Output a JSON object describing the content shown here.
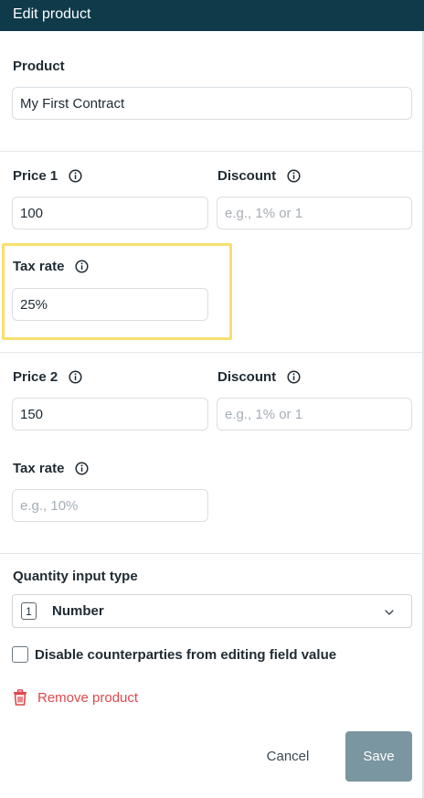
{
  "header": {
    "title": "Edit product"
  },
  "product": {
    "label": "Product",
    "value": "My First Contract"
  },
  "price1": {
    "price_label": "Price 1",
    "price_value": "100",
    "discount_label": "Discount",
    "discount_placeholder": "e.g., 1% or 1",
    "tax_label": "Tax rate",
    "tax_value": "25%"
  },
  "price2": {
    "price_label": "Price 2",
    "price_value": "150",
    "discount_label": "Discount",
    "discount_placeholder": "e.g., 1% or 1",
    "tax_label": "Tax rate",
    "tax_placeholder": "e.g., 10%"
  },
  "quantity": {
    "label": "Quantity input type",
    "icon_text": "1",
    "selected": "Number"
  },
  "disable_editing": {
    "label": "Disable counterparties from editing field value",
    "checked": false
  },
  "remove_label": "Remove product",
  "footer": {
    "cancel_label": "Cancel",
    "save_label": "Save"
  },
  "colors": {
    "header_bg": "#0f3a4a",
    "highlight": "#f7df70",
    "danger": "#e0484d",
    "save_bg": "#7a96a0"
  }
}
